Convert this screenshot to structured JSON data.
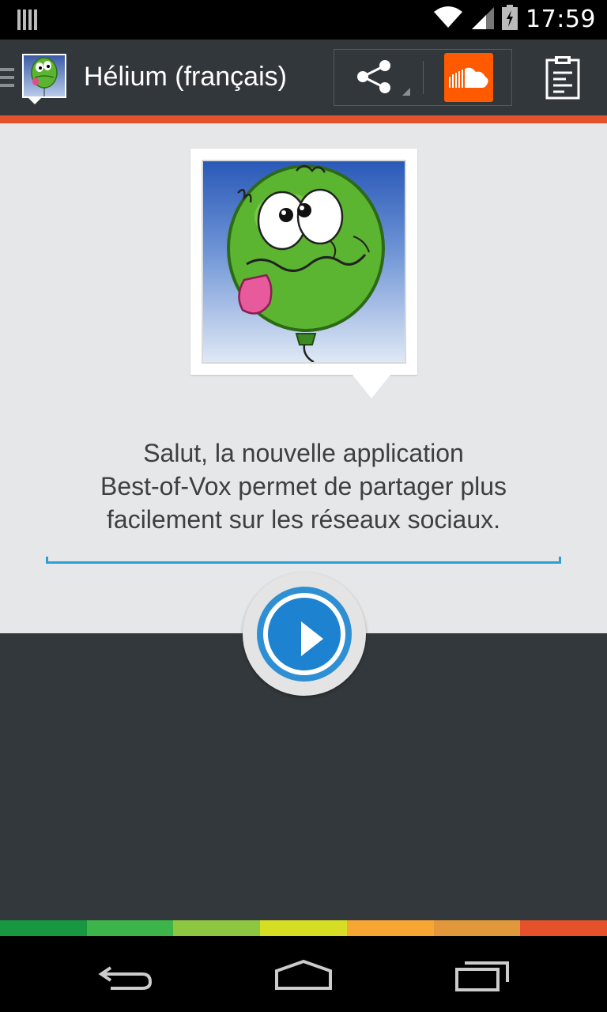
{
  "status_bar": {
    "time": "17:59",
    "icons": [
      "notification-icon",
      "wifi-icon",
      "signal-icon",
      "battery-icon"
    ]
  },
  "action_bar": {
    "title": "Hélium (français)",
    "icons": [
      "menu-icon",
      "app-logo",
      "share-icon",
      "soundcloud-icon",
      "clipboard-icon"
    ],
    "accent_color": "#e4512a",
    "soundcloud_color": "#ff5a00"
  },
  "main": {
    "message_lines": [
      "Salut, la nouvelle application",
      "Best-of-Vox permet de partager plus",
      "facilement sur les réseaux sociaux."
    ],
    "play_icon": "play-icon",
    "play_color": "#1d82cf"
  },
  "color_strip": [
    "#17973f",
    "#3cb449",
    "#8dc63f",
    "#d6de23",
    "#f7a533",
    "#e2983a",
    "#e4512a"
  ],
  "nav_bar": {
    "icons": [
      "back-icon",
      "home-icon",
      "recents-icon"
    ]
  }
}
